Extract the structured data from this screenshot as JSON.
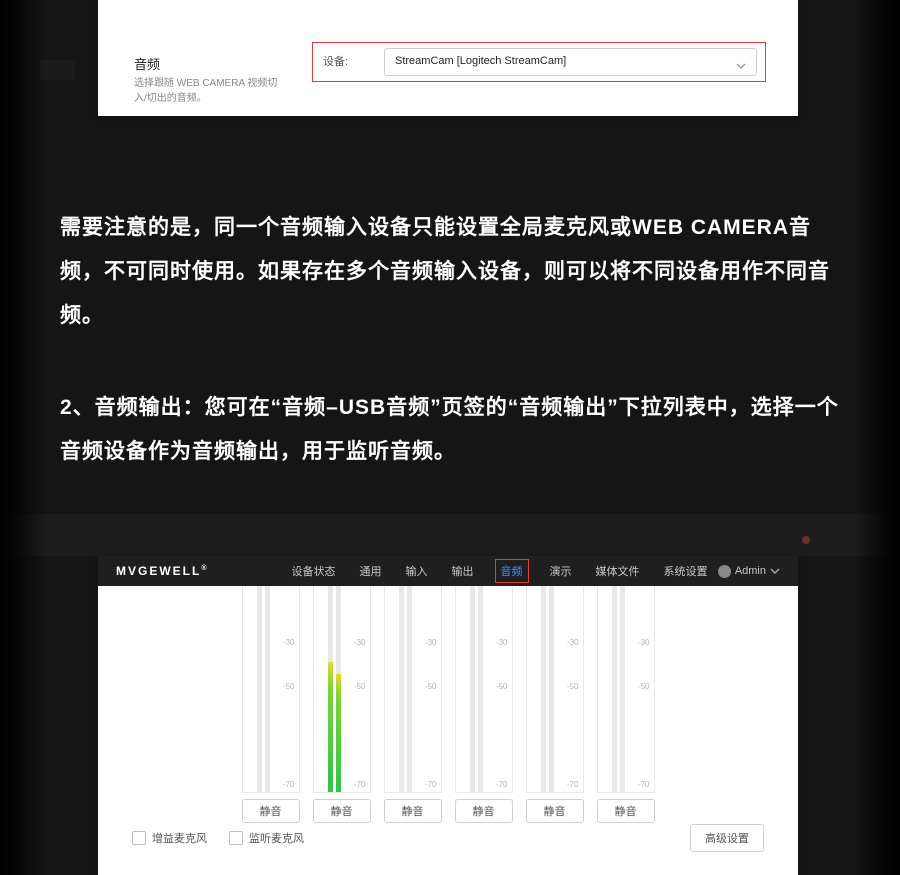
{
  "shot1": {
    "side_title": "音频",
    "side_desc": "选择跟随 WEB CAMERA 视频切入/切出的音频。",
    "field_label": "设备:",
    "device_value": "StreamCam [Logitech StreamCam]"
  },
  "para1": "需要注意的是，同一个音频输入设备只能设置全局麦克风或WEB CAMERA音频，不可同时使用。如果存在多个音频输入设备，则可以将不同设备用作不同音频。",
  "para2": "2、音频输出：您可在“音频–USB音频”页签的“音频输出”下拉列表中，选择一个音频设备作为音频输出，用于监听音频。",
  "shot2": {
    "brand": "MVGEWELL",
    "menu": [
      "设备状态",
      "通用",
      "输入",
      "输出",
      "音频",
      "演示",
      "媒体文件",
      "系统设置"
    ],
    "menu_active_index": 4,
    "admin_label": "Admin",
    "ticks": [
      "",
      "-30",
      "-50",
      "",
      "-70"
    ],
    "mute_label": "静音",
    "cb1": "增益麦克风",
    "cb2": "监听麦克风",
    "adv_label": "高级设置",
    "active_meter_index": 1
  }
}
